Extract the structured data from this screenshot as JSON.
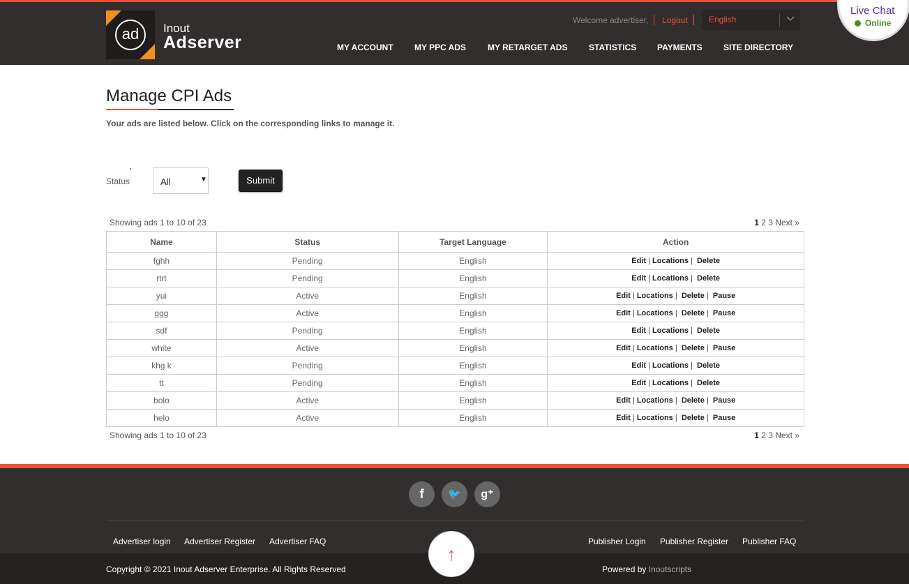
{
  "brand": {
    "logo_mark": "ad",
    "line1": "Inout",
    "line2": "Adserver"
  },
  "topbar": {
    "welcome": "Welcome advertiser,",
    "logout": "Logout",
    "language": "English"
  },
  "nav": [
    "MY ACCOUNT",
    "MY PPC ADS",
    "MY RETARGET ADS",
    "STATISTICS",
    "PAYMENTS",
    "SITE DIRECTORY"
  ],
  "livechat": {
    "title": "Live Chat",
    "status": "Online"
  },
  "main": {
    "title": "Manage CPI Ads",
    "subtitle": "Your ads are listed below. Click on the corresponding links to manage it.",
    "filter": {
      "label": "Status",
      "selected": "All",
      "submit": "Submit"
    },
    "showing": "Showing ads 1 to 10 of 23",
    "pager": {
      "current": "1",
      "pages": "2 3",
      "next": "Next »"
    },
    "columns": [
      "Name",
      "Status",
      "Target Language",
      "Action"
    ],
    "action_labels": {
      "edit": "Edit",
      "locations": "Locations",
      "delete": "Delete",
      "pause": "Pause"
    },
    "rows": [
      {
        "name": "fghh",
        "status": "Pending",
        "language": "English"
      },
      {
        "name": "rtrt",
        "status": "Pending",
        "language": "English"
      },
      {
        "name": "yui",
        "status": "Active",
        "language": "English"
      },
      {
        "name": "ggg",
        "status": "Active",
        "language": "English"
      },
      {
        "name": "sdf",
        "status": "Pending",
        "language": "English"
      },
      {
        "name": "white",
        "status": "Active",
        "language": "English"
      },
      {
        "name": "khg k",
        "status": "Pending",
        "language": "English"
      },
      {
        "name": "tt",
        "status": "Pending",
        "language": "English"
      },
      {
        "name": "bolo",
        "status": "Active",
        "language": "English"
      },
      {
        "name": "helo",
        "status": "Active",
        "language": "English"
      }
    ]
  },
  "footer": {
    "social": [
      {
        "icon": "facebook-icon",
        "glyph": "f"
      },
      {
        "icon": "twitter-icon",
        "glyph": "🐦"
      },
      {
        "icon": "google-plus-icon",
        "glyph": "g⁺"
      }
    ],
    "left_links": [
      "Advertiser login",
      "Advertiser Register",
      "Advertiser FAQ"
    ],
    "right_links": [
      "Publisher Login",
      "Publisher Register",
      "Publisher FAQ"
    ],
    "copyright": "Copyright © 2021 Inout Adserver Enterprise. All Rights Reserved",
    "powered_by": "Powered by",
    "powered_link": "Inoutscripts",
    "to_top": "↑"
  },
  "colors": {
    "accent": "#e8533a",
    "header_bg": "#322e2d",
    "online": "#4c8d22",
    "chat": "#5b2aa8"
  }
}
